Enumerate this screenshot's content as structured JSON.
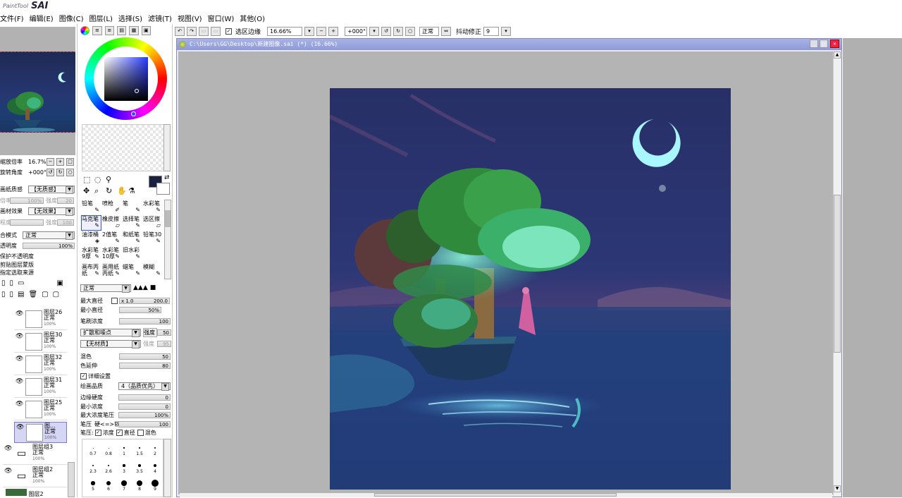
{
  "app": {
    "logo_small": "PaintTool",
    "logo_big": "SAI"
  },
  "menu": [
    "文件(F)",
    "编辑(E)",
    "图像(C)",
    "图层(L)",
    "选择(S)",
    "滤镜(T)",
    "视图(V)",
    "窗口(W)",
    "其他(O)"
  ],
  "navigator": {
    "zoom_label": "缩放倍率",
    "zoom_value": "16.7%",
    "angle_label": "旋转角度",
    "angle_value": "+000°"
  },
  "layer_props": {
    "paper_texture_label": "画纸质感",
    "paper_texture_value": "【无质感】",
    "strength_label": "倍率",
    "strength_value": "100%",
    "strength2_label": "强度",
    "strength2_value": "20",
    "effect_label": "画材效果",
    "effect_value": "【无效果】",
    "degree_label": "程度",
    "degree2_label": "强度",
    "degree2_value": "100",
    "blend_label": "合模式",
    "blend_value": "正常",
    "opacity_label": "透明度",
    "opacity_value": "100%",
    "check_protect": "保护不透明度",
    "check_clip": "剪贴图层蒙版",
    "check_source": "指定选取来源"
  },
  "layers": [
    {
      "name": "图层26",
      "mode": "正常",
      "pct": "100%"
    },
    {
      "name": "图层30",
      "mode": "正常",
      "pct": "100%"
    },
    {
      "name": "图层32",
      "mode": "正常",
      "pct": "100%"
    },
    {
      "name": "图层31",
      "mode": "正常",
      "pct": "100%"
    },
    {
      "name": "图层25",
      "mode": "正常",
      "pct": "100%"
    },
    {
      "name": "图...",
      "mode": "正常",
      "pct": "100%"
    }
  ],
  "groups": [
    {
      "name": "图层组3",
      "mode": "正常",
      "pct": "100%"
    },
    {
      "name": "图层组2",
      "mode": "正常",
      "pct": "100%"
    },
    {
      "name": "图层2"
    }
  ],
  "tools": [
    {
      "label": "铅笔",
      "icon": "✎"
    },
    {
      "label": "喷枪",
      "icon": "✐"
    },
    {
      "label": "笔",
      "icon": "✎"
    },
    {
      "label": "水彩笔",
      "icon": "✎"
    },
    {
      "label": "马克笔",
      "icon": "✎"
    },
    {
      "label": "橡皮擦",
      "icon": "▱"
    },
    {
      "label": "选择笔",
      "icon": "✎"
    },
    {
      "label": "选区擦",
      "icon": "▱"
    },
    {
      "label": "油漆桶",
      "icon": "◈"
    },
    {
      "label": "2值笔",
      "icon": "✎"
    },
    {
      "label": "和纸笔",
      "icon": "✎"
    },
    {
      "label": "铅笔30",
      "icon": "✎"
    },
    {
      "label": "水彩笔9厚",
      "icon": "✎"
    },
    {
      "label": "水彩笔10厚",
      "icon": "✎"
    },
    {
      "label": "旧水彩",
      "icon": "✎"
    },
    {
      "label": "",
      "icon": ""
    },
    {
      "label": "画布丙纸",
      "icon": "✎"
    },
    {
      "label": "画用纸丙纸",
      "icon": "✎"
    },
    {
      "label": "蜡笔",
      "icon": "✎"
    },
    {
      "label": "模糊",
      "icon": "✎"
    }
  ],
  "brush": {
    "mode": "正常",
    "max_diameter_label": "最大直径",
    "max_diameter_mult": "x 1.0",
    "max_diameter_value": "200.0",
    "min_diameter_label": "最小直径",
    "min_diameter_value": "50%",
    "density_label": "笔刷浓度",
    "density_value": "100",
    "shape_value": "扩散和噪点",
    "shape_strength_label": "强度",
    "shape_strength_value": "50",
    "texture_value": "【无材质】",
    "texture_strength_label": "强度",
    "texture_strength_value": "95",
    "mix_label": "混色",
    "mix_value": "50",
    "extend_label": "色延伸",
    "extend_value": "80",
    "detail_label": "详细设置",
    "quality_label": "绘画品质",
    "quality_value": "4（品质优先）",
    "edge_label": "边缘硬度",
    "edge_value": "0",
    "min_density_label": "最小浓度",
    "min_density_value": "0",
    "max_pressure_label": "最大浓度笔压",
    "max_pressure_value": "100%",
    "pressure_label": "笔压",
    "pressure_hardness": "硬<=>软",
    "pressure_value": "100",
    "pressure_row_label": "笔压:",
    "pressure_density": "浓度",
    "pressure_diameter": "直径",
    "pressure_mix": "混色"
  },
  "brush_sizes": [
    [
      "0.7",
      "0.8",
      "1",
      "1.5",
      "2"
    ],
    [
      "2.3",
      "2.6",
      "3",
      "3.5",
      "4"
    ],
    [
      "5",
      "6",
      "7",
      "8",
      "9"
    ]
  ],
  "toolbar": {
    "sel_edge_label": "选区边缘",
    "zoom": "16.66%",
    "angle": "+000°",
    "blend": "正常",
    "stabilizer_label": "抖动修正",
    "stabilizer_value": "9"
  },
  "canvas_window": {
    "title": "C:\\Users\\GG\\Desktop\\新建图像.sai (*) (16.66%)"
  },
  "colors": {
    "main_color": "#1a2040",
    "accent": "#3355cc",
    "title_bar": "#98a3dd"
  }
}
